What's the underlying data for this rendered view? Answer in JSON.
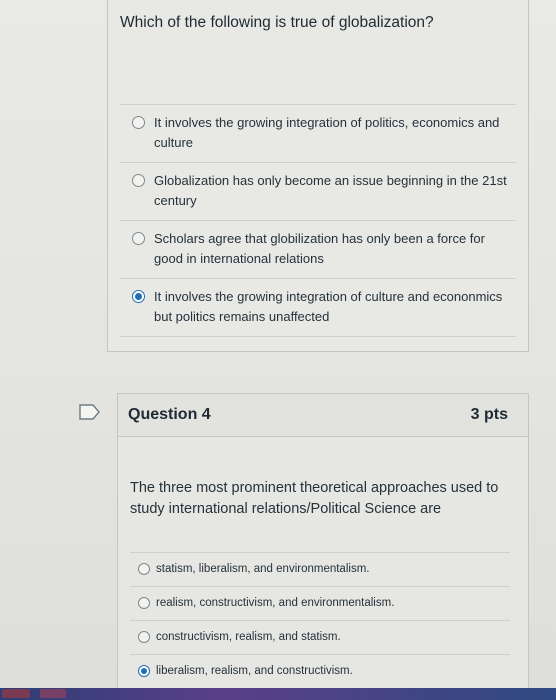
{
  "question3": {
    "prompt": "Which of the following is true of globalization?",
    "answers": [
      {
        "text": "It involves the growing integration of politics, economics and culture",
        "selected": false
      },
      {
        "text": "Globalization has only become an issue beginning in the 21st century",
        "selected": false
      },
      {
        "text": "Scholars agree that globilization has only been a force for good in international relations",
        "selected": false
      },
      {
        "text": "It involves the growing integration of culture and econonmics but politics remains unaffected",
        "selected": true
      }
    ]
  },
  "question4": {
    "title": "Question 4",
    "points": "3 pts",
    "prompt": "The three most prominent theoretical approaches used to study international relations/Political Science are",
    "answers": [
      {
        "text": "statism, liberalism, and environmentalism.",
        "selected": false
      },
      {
        "text": "realism, constructivism, and environmentalism.",
        "selected": false
      },
      {
        "text": "constructivism, realism, and statism.",
        "selected": false
      },
      {
        "text": "liberalism, realism, and constructivism.",
        "selected": true
      }
    ]
  },
  "colors": {
    "accent": "#1f6fb8",
    "taskbar": "#3a3f7e"
  },
  "icons": {
    "flag": "flag-icon"
  }
}
